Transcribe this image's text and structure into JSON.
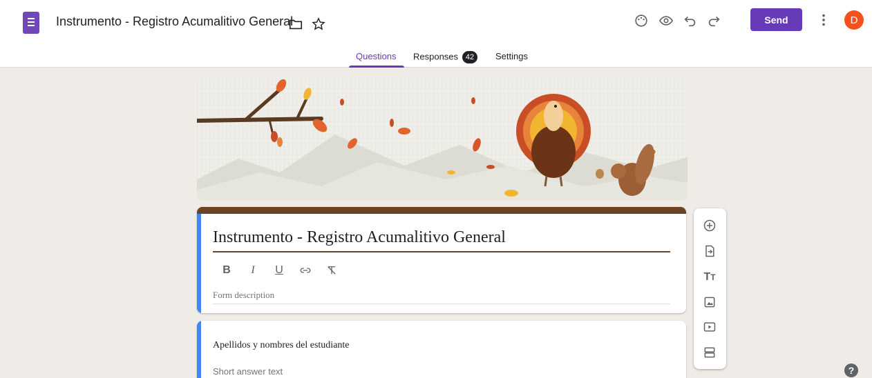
{
  "header": {
    "doc_title": "Instrumento - Registro Acumalitivo General",
    "send_label": "Send",
    "avatar_letter": "D",
    "icons": [
      "folder-icon",
      "star-icon",
      "palette-icon",
      "preview-eye-icon",
      "undo-icon",
      "redo-icon",
      "more-vert-icon"
    ]
  },
  "tabs": [
    {
      "label": "Questions"
    },
    {
      "label": "Responses",
      "badge": "42"
    },
    {
      "label": "Settings"
    }
  ],
  "form": {
    "title": "Instrumento - Registro Acumalitivo General",
    "description_placeholder": "Form description",
    "format_buttons": [
      "B",
      "I",
      "U"
    ]
  },
  "question": {
    "label": "Apellidos y nombres del estudiante",
    "answer_placeholder": "Short answer text"
  },
  "sidebar_tools": [
    "add-question-icon",
    "import-questions-icon",
    "add-title-icon",
    "add-image-icon",
    "add-video-icon",
    "add-section-icon"
  ],
  "help_label": "?",
  "colors": {
    "accent": "#673ab7",
    "theme": "#6d4423",
    "focus": "#4285f4",
    "avatar": "#f4511e"
  }
}
